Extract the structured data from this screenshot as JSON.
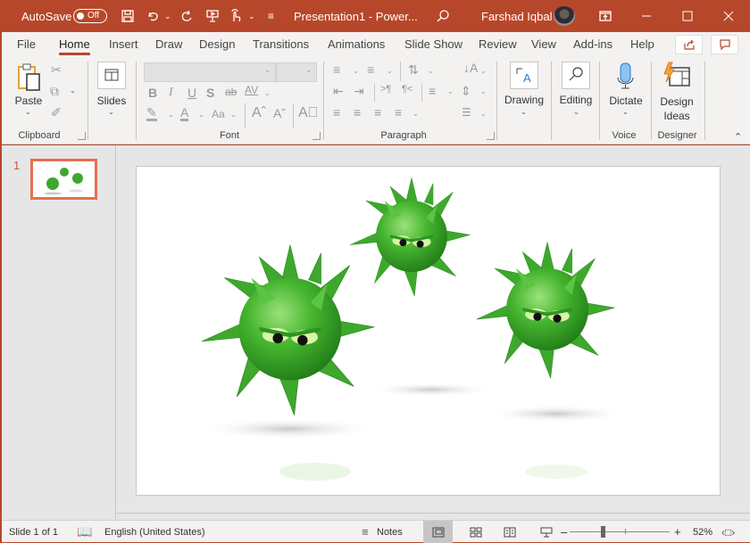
{
  "titlebar": {
    "autosave_label": "AutoSave",
    "autosave_state": "Off",
    "document_title": "Presentation1  -  Power...",
    "user_name": "Farshad Iqbal",
    "brand_color": "#b7472a"
  },
  "tabs": [
    {
      "label": "File"
    },
    {
      "label": "Home",
      "active": true
    },
    {
      "label": "Insert"
    },
    {
      "label": "Draw"
    },
    {
      "label": "Design"
    },
    {
      "label": "Transitions"
    },
    {
      "label": "Animations"
    },
    {
      "label": "Slide Show"
    },
    {
      "label": "Review"
    },
    {
      "label": "View"
    },
    {
      "label": "Add-ins"
    },
    {
      "label": "Help"
    }
  ],
  "ribbon": {
    "clipboard": {
      "paste_label": "Paste",
      "group_label": "Clipboard"
    },
    "slides": {
      "label": "Slides"
    },
    "font": {
      "group_label": "Font",
      "font_name_value": "",
      "font_size_value": ""
    },
    "paragraph": {
      "group_label": "Paragraph"
    },
    "drawing": {
      "label": "Drawing"
    },
    "editing": {
      "label": "Editing"
    },
    "voice": {
      "dictate_label": "Dictate",
      "group_label": "Voice"
    },
    "designer": {
      "design_ideas_line1": "Design",
      "design_ideas_line2": "Ideas",
      "group_label": "Designer"
    }
  },
  "thumbnails": [
    {
      "number": "1",
      "selected": true,
      "accent": "#e66f4f"
    }
  ],
  "slide": {
    "content": "three-green-spiky-virus-characters"
  },
  "statusbar": {
    "slide_info": "Slide 1 of 1",
    "language": "English (United States)",
    "notes_label": "Notes",
    "zoom_level": "52%",
    "zoom_percent": 52
  }
}
